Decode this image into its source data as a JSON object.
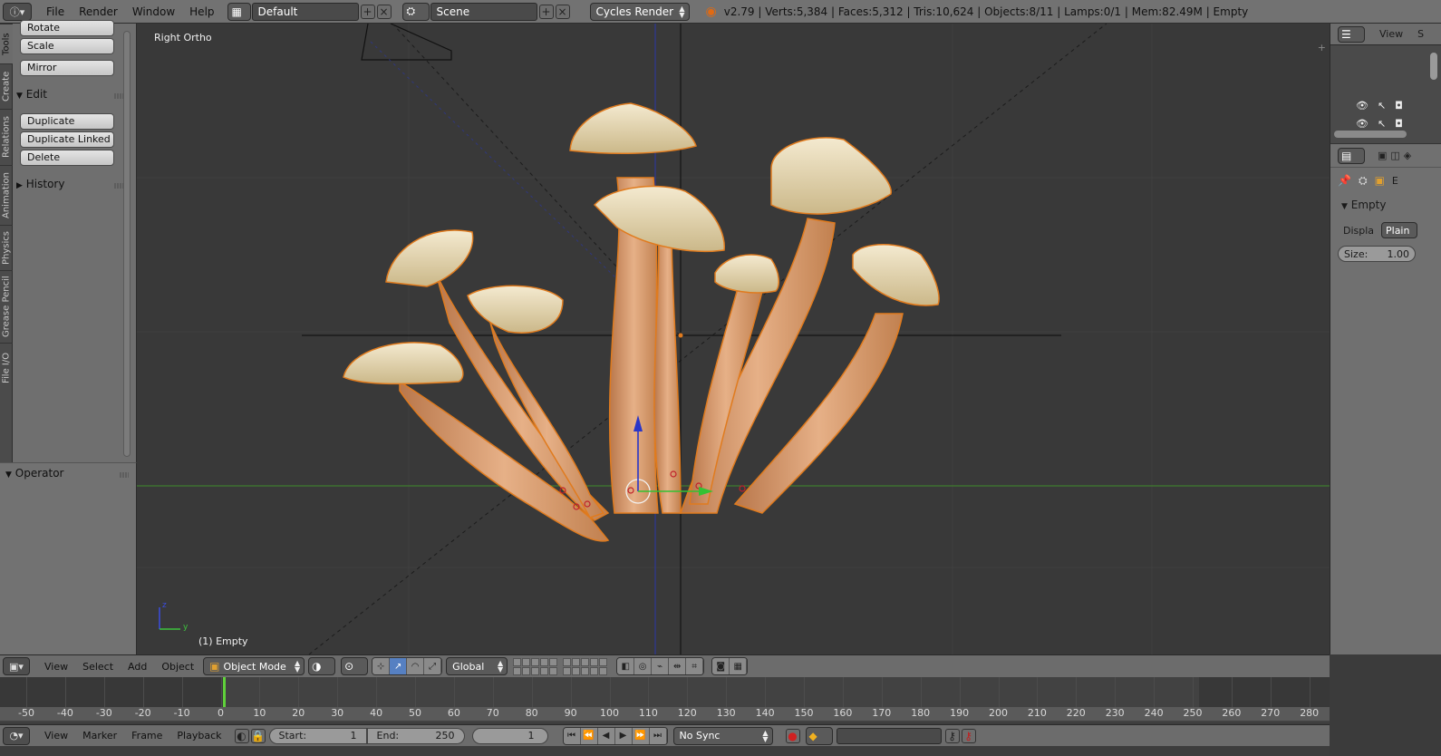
{
  "topbar": {
    "menus": [
      "File",
      "Render",
      "Window",
      "Help"
    ],
    "layout": "Default",
    "scene": "Scene",
    "engine": "Cycles Render",
    "stats": "v2.79 | Verts:5,384 | Faces:5,312 | Tris:10,624 | Objects:8/11 | Lamps:0/1 | Mem:82.49M | Empty"
  },
  "tabs": [
    "Tools",
    "Create",
    "Relations",
    "Animation",
    "Physics",
    "Grease Pencil",
    "File I/O"
  ],
  "toolshelf": {
    "transform_buttons": [
      "Rotate",
      "Scale",
      "Mirror"
    ],
    "edit_title": "Edit",
    "edit_buttons": [
      "Duplicate",
      "Duplicate Linked",
      "Delete"
    ],
    "history_title": "History",
    "operator_title": "Operator"
  },
  "viewport": {
    "view_name": "Right Ortho",
    "active_object": "(1) Empty",
    "axis_z": "z",
    "axis_y": "y"
  },
  "outliner": {
    "view_label": "View",
    "cut_label": "S"
  },
  "properties": {
    "context_label": "E",
    "panel_title": "Empty",
    "display_label": "Displa",
    "display_value": "Plain",
    "size_label": "Size:",
    "size_value": "1.00"
  },
  "view3d_header": {
    "menus": [
      "View",
      "Select",
      "Add",
      "Object"
    ],
    "mode": "Object Mode",
    "orientation": "Global"
  },
  "timeline": {
    "ticks": [
      "-50",
      "-40",
      "-30",
      "-20",
      "-10",
      "0",
      "10",
      "20",
      "30",
      "40",
      "50",
      "60",
      "70",
      "80",
      "90",
      "100",
      "110",
      "120",
      "130",
      "140",
      "150",
      "160",
      "170",
      "180",
      "190",
      "200",
      "210",
      "220",
      "230",
      "240",
      "250",
      "260",
      "270",
      "280"
    ],
    "current_frame_value": 1,
    "menus": [
      "View",
      "Marker",
      "Frame",
      "Playback"
    ],
    "start_label": "Start:",
    "start_value": "1",
    "end_label": "End:",
    "end_value": "250",
    "frame_value": "1",
    "sync": "No Sync"
  },
  "colors": {
    "selection_outline": "#e07b1e",
    "mushroom_stem": "#d89866",
    "mushroom_cap": "#e9dcb0",
    "x_axis_green": "#4c9a2a",
    "z_axis_blue": "#2233aa",
    "playhead": "#5fd13a"
  }
}
